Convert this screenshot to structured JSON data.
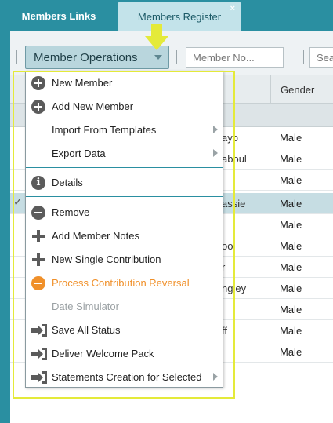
{
  "tabs": [
    {
      "label": "Members Links",
      "active": true
    },
    {
      "label": "Members Register",
      "active": false
    }
  ],
  "tab_close_glyph": "×",
  "toolbar": {
    "operations_label": "Member Operations",
    "member_no_placeholder": "Member No...",
    "search_placeholder": "Search"
  },
  "table": {
    "gender_header": "Gender",
    "rows": [
      {
        "name": "ayo",
        "gender": "Male",
        "selected": false,
        "checked": false
      },
      {
        "name": "aboul",
        "gender": "Male",
        "selected": false,
        "checked": false
      },
      {
        "name": "",
        "gender": "Male",
        "selected": false,
        "checked": false
      },
      {
        "name": "assie",
        "gender": "Male",
        "selected": true,
        "checked": true
      },
      {
        "name": "",
        "gender": "Male",
        "selected": false,
        "checked": false
      },
      {
        "name": "oo",
        "gender": "Male",
        "selected": false,
        "checked": false
      },
      {
        "name": "r",
        "gender": "Male",
        "selected": false,
        "checked": false
      },
      {
        "name": "ngley",
        "gender": "Male",
        "selected": false,
        "checked": false
      },
      {
        "name": "",
        "gender": "Male",
        "selected": false,
        "checked": false
      },
      {
        "name": "ff",
        "gender": "Male",
        "selected": false,
        "checked": false
      },
      {
        "name": "",
        "gender": "Male",
        "selected": false,
        "checked": false
      }
    ]
  },
  "menu": {
    "items": [
      {
        "label": "New Member",
        "icon": "plus-circle-icon"
      },
      {
        "label": "Add New Member",
        "icon": "plus-circle-icon"
      },
      {
        "label": "Import From Templates",
        "icon": "none",
        "submenu": true
      },
      {
        "label": "Export Data",
        "icon": "none",
        "submenu": true
      },
      {
        "label": "Details",
        "icon": "info-circle-icon"
      },
      {
        "label": "Remove",
        "icon": "minus-circle-icon"
      },
      {
        "label": "Add Member Notes",
        "icon": "plus-icon"
      },
      {
        "label": "New Single Contribution",
        "icon": "plus-icon"
      },
      {
        "label": "Process Contribution Reversal",
        "icon": "minus-circle-icon",
        "color": "#f0902a"
      },
      {
        "label": "Date Simulator",
        "icon": "none",
        "disabled": true
      },
      {
        "label": "Save All Status",
        "icon": "sign-in-icon"
      },
      {
        "label": "Deliver Welcome Pack",
        "icon": "sign-in-icon"
      },
      {
        "label": "Statements Creation for Selected",
        "icon": "sign-in-icon",
        "submenu": true
      }
    ]
  },
  "colors": {
    "brand_teal": "#2a8fa1",
    "highlight_yellow": "#e4ea3a",
    "accent_orange": "#f0902a"
  }
}
